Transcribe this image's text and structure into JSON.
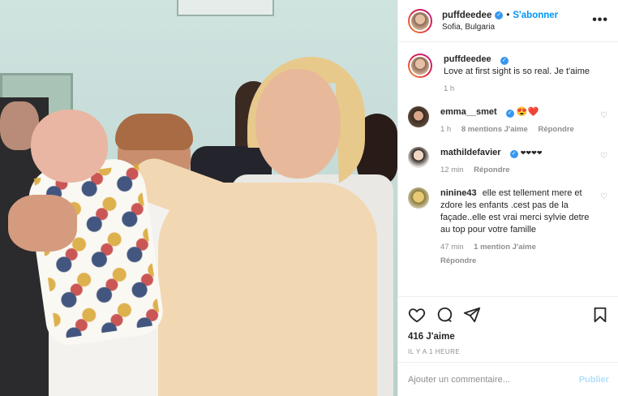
{
  "header": {
    "username": "puffdeedee",
    "verified_glyph": "✓",
    "separator": "•",
    "follow_label": "S'abonner",
    "location": "Sofia, Bulgaria",
    "more_glyph": "•••"
  },
  "caption": {
    "username": "puffdeedee",
    "text": "Love at first sight is so real. Je t'aime",
    "time": "1 h"
  },
  "comments": [
    {
      "username": "emma__smet",
      "text": "😍❤️",
      "time": "1 h",
      "likes": "8 mentions J'aime",
      "reply": "Répondre"
    },
    {
      "username": "mathildefavier",
      "text": "❤❤❤❤",
      "time": "12 min",
      "likes": "",
      "reply": "Répondre"
    },
    {
      "username": "ninine43",
      "text": "elle est tellement mere et zdore les enfants .cest pas de la façade..elle est vrai merci sylvie detre au top pour votre famille",
      "time": "47 min",
      "likes": "1 mention J'aime",
      "reply": "Répondre"
    }
  ],
  "actions": {
    "likes": "416 J'aime",
    "posted": "IL Y A 1 HEURE"
  },
  "add_comment": {
    "placeholder": "Ajouter un commentaire...",
    "publish_label": "Publier"
  },
  "colors": {
    "accent": "#0095f6",
    "verified": "#3897f0",
    "muted": "#8e8e8e",
    "publish_disabled": "#b2dffc"
  },
  "icons": [
    "like-icon",
    "comment-icon",
    "share-icon",
    "bookmark-icon",
    "more-icon",
    "heart-icon",
    "verified-icon"
  ]
}
